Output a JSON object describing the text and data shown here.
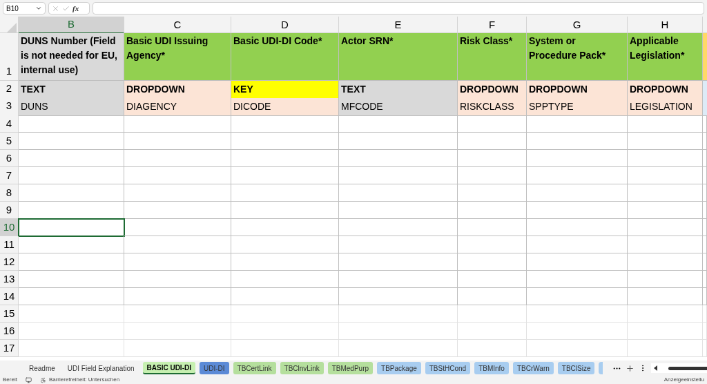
{
  "name_box": "B10",
  "function_label": "fx",
  "columns": [
    {
      "letter": "B",
      "selected": true
    },
    {
      "letter": "C",
      "selected": false
    },
    {
      "letter": "D",
      "selected": false
    },
    {
      "letter": "E",
      "selected": false
    },
    {
      "letter": "F",
      "selected": false
    },
    {
      "letter": "G",
      "selected": false
    },
    {
      "letter": "H",
      "selected": false
    }
  ],
  "header_rows": [
    {
      "number": "1",
      "cells": [
        {
          "text": "DUNS Number (Field is not needed for EU, internal use)",
          "color": "#d9d9d9"
        },
        {
          "text": "Basic UDI Issuing Agency*",
          "color": "#92d050"
        },
        {
          "text": "Basic UDI-DI Code*",
          "color": "#92d050"
        },
        {
          "text": "Actor SRN*",
          "color": "#92d050"
        },
        {
          "text": "Risk Class*",
          "color": "#92d050"
        },
        {
          "text": "System or Procedure Pack*",
          "color": "#92d050"
        },
        {
          "text": "Applicable Legislation*",
          "color": "#92d050"
        },
        {
          "color": "#ffd966"
        }
      ]
    },
    {
      "number": "2",
      "cells": [
        {
          "text": "TEXT",
          "color": "#d9d9d9"
        },
        {
          "text": "DROPDOWN",
          "color": "#fce4d6"
        },
        {
          "text": "KEY",
          "color": "#ffff00"
        },
        {
          "text": "TEXT",
          "color": "#d9d9d9"
        },
        {
          "text": "DROPDOWN",
          "color": "#fce4d6"
        },
        {
          "text": "DROPDOWN",
          "color": "#fce4d6"
        },
        {
          "text": "DROPDOWN",
          "color": "#fce4d6"
        },
        {
          "color": "#ddebf7"
        }
      ]
    },
    {
      "number": "3",
      "cells": [
        {
          "text": "DUNS",
          "color": "#d9d9d9"
        },
        {
          "text": "DIAGENCY",
          "color": "#fce4d6"
        },
        {
          "text": "DICODE",
          "color": "#fce4d6"
        },
        {
          "text": "MFCODE",
          "color": "#d9d9d9"
        },
        {
          "text": "RISKCLASS",
          "color": "#fce4d6"
        },
        {
          "text": "SPPTYPE",
          "color": "#fce4d6"
        },
        {
          "text": "LEGISLATION",
          "color": "#fce4d6"
        },
        {
          "color": "#ddebf7"
        }
      ]
    }
  ],
  "empty_rows": [
    {
      "number": "4",
      "selected": false
    },
    {
      "number": "5",
      "selected": false
    },
    {
      "number": "6",
      "selected": false
    },
    {
      "number": "7",
      "selected": false
    },
    {
      "number": "8",
      "selected": false
    },
    {
      "number": "9",
      "selected": false
    },
    {
      "number": "10",
      "selected": true
    },
    {
      "number": "11",
      "selected": false
    },
    {
      "number": "12",
      "selected": false
    },
    {
      "number": "13",
      "selected": false
    },
    {
      "number": "14",
      "selected": false
    },
    {
      "number": "15",
      "selected": false
    },
    {
      "number": "16",
      "selected": false
    },
    {
      "number": "17",
      "selected": false
    }
  ],
  "sheet_tabs": [
    {
      "label": "Readme",
      "selected": false
    },
    {
      "label": "UDI Field Explanation",
      "selected": false
    },
    {
      "label": "BASIC UDI-DI",
      "selected": true,
      "color": "#c6efb0"
    },
    {
      "label": "UDI-DI",
      "selected": false,
      "color": "#5b8ad6"
    },
    {
      "label": "TBCertLink",
      "selected": false,
      "color": "#b5df9d"
    },
    {
      "label": "TBClnvLink",
      "selected": false,
      "color": "#b5df9d"
    },
    {
      "label": "TBMedPurp",
      "selected": false,
      "color": "#b5df9d"
    },
    {
      "label": "TBPackage",
      "selected": false,
      "color": "#a8cdf0"
    },
    {
      "label": "TBStHCond",
      "selected": false,
      "color": "#a8cdf0"
    },
    {
      "label": "TBMInfo",
      "selected": false,
      "color": "#a8cdf0"
    },
    {
      "label": "TBCrWarn",
      "selected": false,
      "color": "#a8cdf0"
    },
    {
      "label": "TBClSize",
      "selected": false,
      "color": "#a8cdf0"
    }
  ],
  "status_bar": {
    "mode": "Bereit",
    "accessibility": "Barrierefreiheit: Untersuchen",
    "display_settings": "Anzeigeeinstellu"
  }
}
